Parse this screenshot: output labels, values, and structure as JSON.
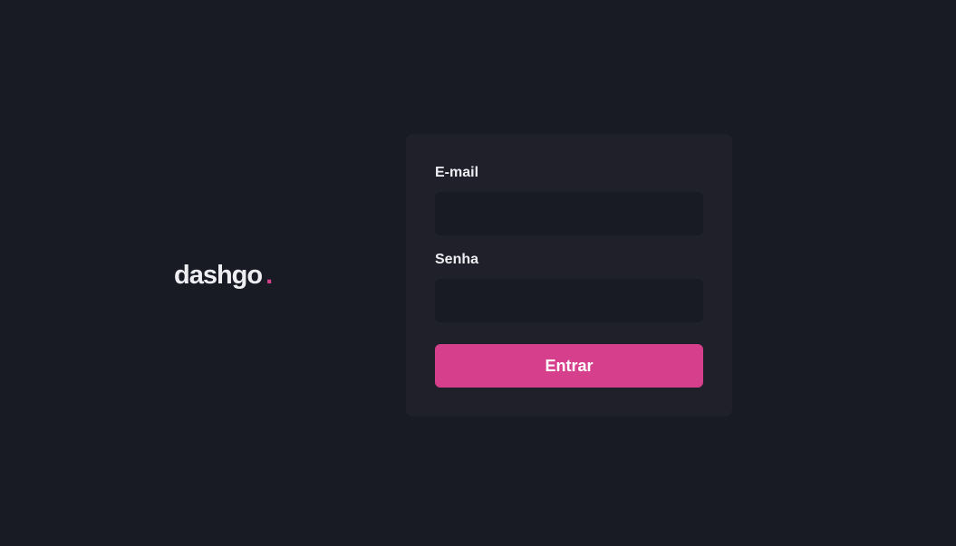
{
  "logo": {
    "text": "dashgo",
    "dot": "."
  },
  "form": {
    "email_label": "E-mail",
    "email_value": "",
    "password_label": "Senha",
    "password_value": "",
    "submit_label": "Entrar"
  },
  "colors": {
    "background": "#181b23",
    "card": "#1f2029",
    "input": "#181b23",
    "accent": "#d53f8c",
    "text": "#eeeef2"
  }
}
